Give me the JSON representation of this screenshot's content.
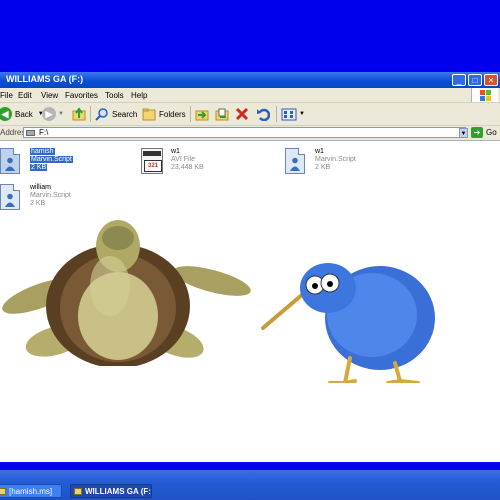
{
  "window": {
    "title": "WILLIAMS GA (F:)",
    "controls": {
      "minimize": "_",
      "maximize": "□",
      "close": "✕"
    }
  },
  "menubar": {
    "items": [
      "File",
      "Edit",
      "View",
      "Favorites",
      "Tools",
      "Help"
    ]
  },
  "toolbar": {
    "back_label": "Back",
    "search_label": "Search",
    "folders_label": "Folders"
  },
  "addressbar": {
    "label": "Address",
    "value": "F:\\",
    "go_label": "Go"
  },
  "files": [
    {
      "name": "hamish",
      "type": "Marvin.Script",
      "size": "2 KB",
      "icon": "marvin-script-icon",
      "selected": true
    },
    {
      "name": "w1",
      "type": "AVI File",
      "size": "23,448 KB",
      "icon": "avi-file-icon",
      "selected": false
    },
    {
      "name": "w1",
      "type": "Marvin.Script",
      "size": "2 KB",
      "icon": "marvin-script-icon",
      "selected": false
    },
    {
      "name": "william",
      "type": "Marvin.Script",
      "size": "2 KB",
      "icon": "marvin-script-icon",
      "selected": false
    }
  ],
  "characters": [
    "turtle-character",
    "kiwi-bird-character"
  ],
  "taskbar": {
    "buttons": [
      {
        "label": "[hamish.ms]",
        "active": false
      },
      {
        "label": "WILLIAMS GA (F:)",
        "active": true
      }
    ]
  },
  "colors": {
    "desktop": "#0000ee",
    "titlebar": "#0a4fd6",
    "selection": "#316ac5",
    "chrome": "#ece9d8"
  }
}
